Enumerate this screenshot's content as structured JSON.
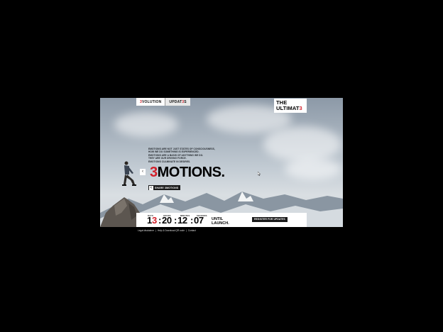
{
  "nav": {
    "tab1": {
      "highlight": "3",
      "rest": "VOLUTION"
    },
    "tab2": {
      "pre": "UPDAT",
      "highlight": "3",
      "rest": "S"
    }
  },
  "logo": {
    "line1": "THE",
    "line2_pre": "ULTIMAT",
    "line2_highlight": "3"
  },
  "intro": [
    "EMOTIONS ARE NOT JUST STATES OF CONSCIOUSNESS,",
    "HOW WE DO SOMETHING IS EXPERIENCED.",
    "EMOTIONS ARE A BASIS OF ANYTHING WE DO.",
    "THEY ARE OUR DRIVING FORCE.",
    "EMOTIONS CULMINATE IN DESIRES."
  ],
  "headline": {
    "highlight": "3",
    "rest": "MOTIONS."
  },
  "prev_arrow": "‹",
  "share": {
    "icon": "<",
    "label": "SHARE 3MOTIONS"
  },
  "countdown": {
    "labels": {
      "days": "DAYS",
      "hours": "HOURS",
      "minutes": "MINUTES",
      "seconds": "SECONDS"
    },
    "days_first": "1",
    "days_second": "3",
    "hours": "20",
    "minutes": "12",
    "seconds": "07",
    "until_line1": "UNTIL",
    "until_line2": "LAUNCH."
  },
  "register_label": "REGISTER FOR UPDATES",
  "footer": [
    "Legal disclaimer",
    "|",
    "Help & Download QR code",
    "|",
    "Contact"
  ],
  "colors": {
    "accent": "#d21f2a",
    "background": "#000000"
  }
}
